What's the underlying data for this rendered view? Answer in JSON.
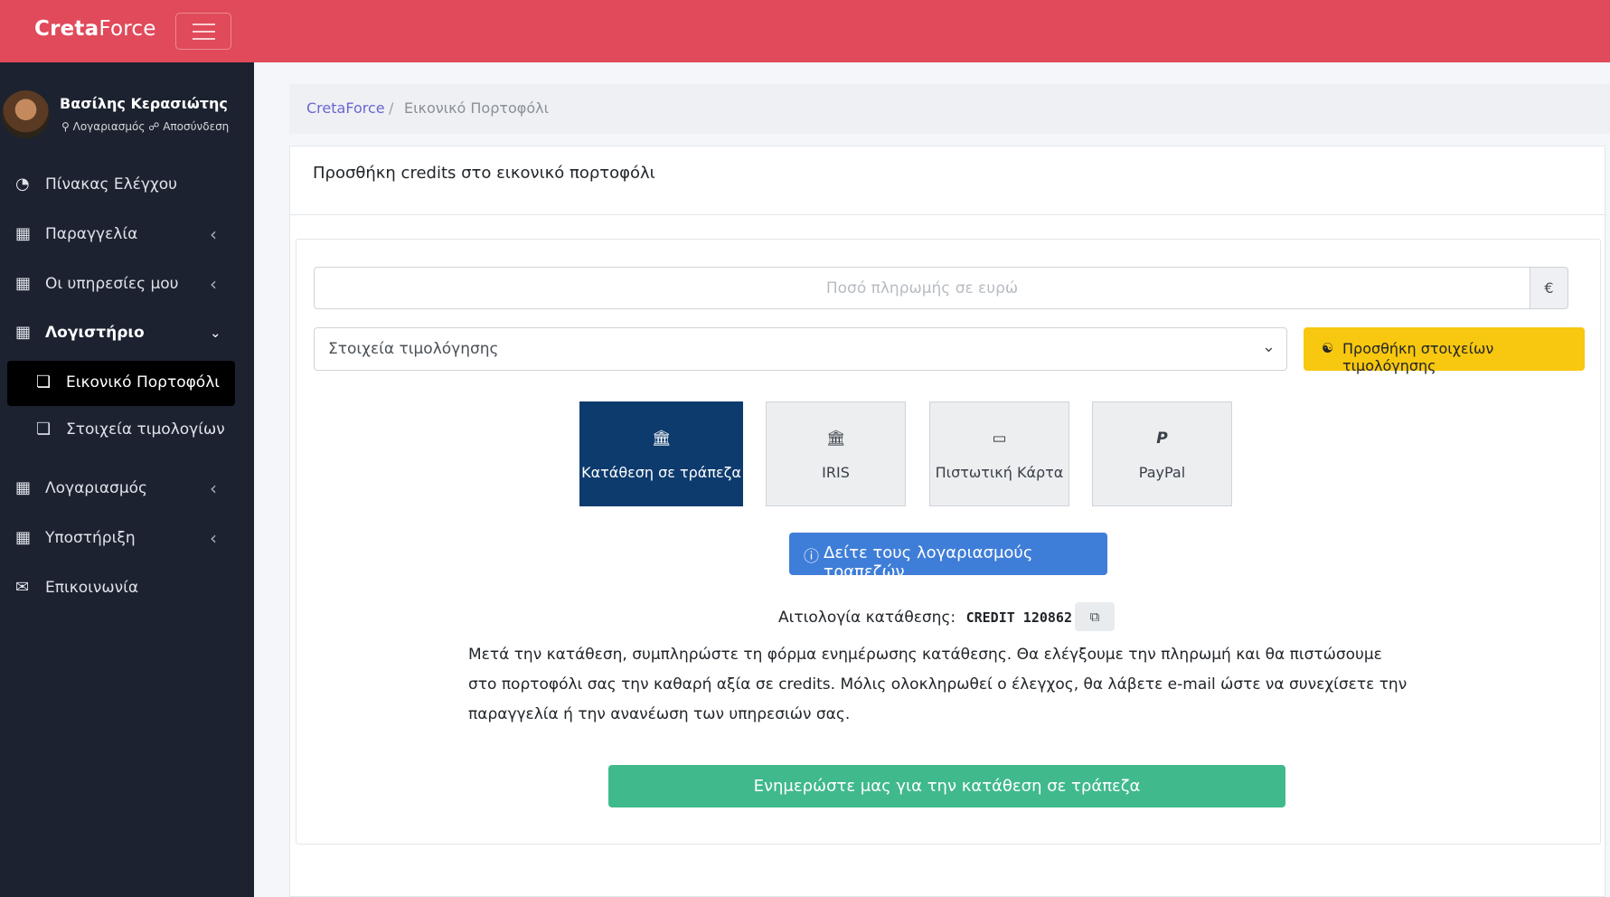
{
  "brand": {
    "bold": "Creta",
    "light": "Force"
  },
  "sidebar": {
    "user_name": "Βασίλης Κερασιώτης",
    "account_link": "Λογαριασμός",
    "logout_link": "Αποσύνδεση",
    "items": [
      {
        "label": "Πίνακας Ελέγχου",
        "icon": "dashboard-icon"
      },
      {
        "label": "Παραγγελία",
        "icon": "calendar-icon"
      },
      {
        "label": "Οι υπηρεσίες μου",
        "icon": "calendar-icon"
      },
      {
        "label": "Λογιστήριο",
        "icon": "calendar-icon"
      },
      {
        "label": "Λογαριασμός",
        "icon": "calendar-icon"
      },
      {
        "label": "Υποστήριξη",
        "icon": "calendar-icon"
      },
      {
        "label": "Επικοινωνία",
        "icon": "envelope-icon"
      }
    ],
    "subitems": [
      {
        "label": "Εικονικό Πορτοφόλι",
        "icon": "copy-icon"
      },
      {
        "label": "Στοιχεία τιμολογίων",
        "icon": "copy-icon"
      }
    ]
  },
  "breadcrumb": {
    "home": "CretaForce",
    "separator": "/",
    "current": "Εικονικό Πορτοφόλι"
  },
  "card": {
    "title": "Προσθήκη credits στο εικονικό πορτοφόλι",
    "amount_placeholder": "Ποσό πληρωμής σε ευρώ",
    "currency": "€",
    "billing_select": "Στοιχεία τιμολόγησης",
    "add_billing_label": "Προσθήκη στοιχείων τιμολόγησης",
    "methods": [
      {
        "label": "Κατάθεση σε τράπεζα",
        "icon": "bank-icon"
      },
      {
        "label": "IRIS",
        "icon": "bank-icon"
      },
      {
        "label": "Πιστωτική Κάρτα",
        "icon": "credit-card-icon"
      },
      {
        "label": "PayPal",
        "icon": "paypal-icon"
      }
    ],
    "bank_accounts_label": "Δείτε τους λογαριασμούς τραπεζών",
    "reference_label": "Αιτιολογία κατάθεσης:",
    "reference_code": "CREDIT 120862",
    "description": "Μετά την κατάθεση, συμπληρώστε τη φόρμα ενημέρωσης κατάθεσης. Θα ελέγξουμε την πληρωμή και θα πιστώσουμε στο πορτοφόλι σας την καθαρή αξία σε credits. Μόλις ολοκληρωθεί ο έλεγχος, θα λάβετε e-mail ώστε να συνεχίσετε την παραγγελία ή την ανανέωση των υπηρεσιών σας.",
    "notify_label": "Ενημερώστε μας για την κατάθεση σε τράπεζα"
  },
  "colors": {
    "topbar": "#e04a5a",
    "sidebar": "#1c2230",
    "accent_yellow": "#f8c70f",
    "active_method": "#0e3b6e",
    "info": "#3f7ed8",
    "success": "#40b98d"
  }
}
